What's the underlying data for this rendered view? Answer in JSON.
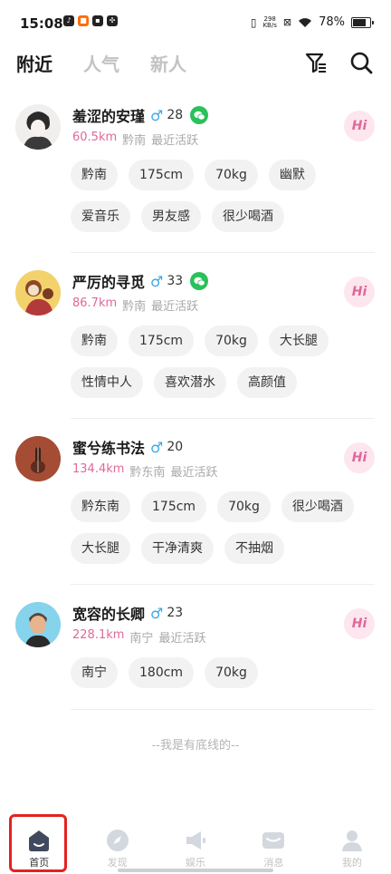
{
  "status_bar": {
    "time": "15:08",
    "net_speed_value": "298",
    "net_speed_unit": "KB/s",
    "battery": "78%"
  },
  "tabs": [
    {
      "label": "附近",
      "active": true
    },
    {
      "label": "人气",
      "active": false
    },
    {
      "label": "新人",
      "active": false
    }
  ],
  "icons": {
    "filter": "filter-icon",
    "search": "search-icon",
    "hi": "hi-greeting-icon",
    "wechat": "wechat-icon"
  },
  "colors": {
    "distance": "#e0689a",
    "male_symbol": "#3aa6ea",
    "wechat": "#29c15a",
    "hi_bg": "#fde6ee",
    "highlight": "#e32222"
  },
  "users": [
    {
      "name": "羞涩的安瑾",
      "gender": "♂",
      "age": "28",
      "wechat": true,
      "distance": "60.5km",
      "location": "黔南",
      "activity": "最近活跃",
      "tags": [
        "黔南",
        "175cm",
        "70kg",
        "幽默",
        "爱音乐",
        "男友感",
        "很少喝酒"
      ],
      "hi_label": "Hi"
    },
    {
      "name": "严厉的寻觅",
      "gender": "♂",
      "age": "33",
      "wechat": true,
      "distance": "86.7km",
      "location": "黔南",
      "activity": "最近活跃",
      "tags": [
        "黔南",
        "175cm",
        "70kg",
        "大长腿",
        "性情中人",
        "喜欢潜水",
        "高颜值"
      ],
      "hi_label": "Hi"
    },
    {
      "name": "蜜兮练书法",
      "gender": "♂",
      "age": "20",
      "wechat": false,
      "distance": "134.4km",
      "location": "黔东南",
      "activity": "最近活跃",
      "tags": [
        "黔东南",
        "175cm",
        "70kg",
        "很少喝酒",
        "大长腿",
        "干净清爽",
        "不抽烟"
      ],
      "hi_label": "Hi"
    },
    {
      "name": "宽容的长卿",
      "gender": "♂",
      "age": "23",
      "wechat": false,
      "distance": "228.1km",
      "location": "南宁",
      "activity": "最近活跃",
      "tags": [
        "南宁",
        "180cm",
        "70kg"
      ],
      "hi_label": "Hi"
    }
  ],
  "footer_note": "--我是有底线的--",
  "bottom_nav": [
    {
      "label": "首页",
      "icon": "home-icon",
      "active": true
    },
    {
      "label": "发现",
      "icon": "compass-icon",
      "active": false
    },
    {
      "label": "娱乐",
      "icon": "megaphone-icon",
      "active": false
    },
    {
      "label": "消息",
      "icon": "message-icon",
      "active": false
    },
    {
      "label": "我的",
      "icon": "profile-icon",
      "active": false
    }
  ]
}
